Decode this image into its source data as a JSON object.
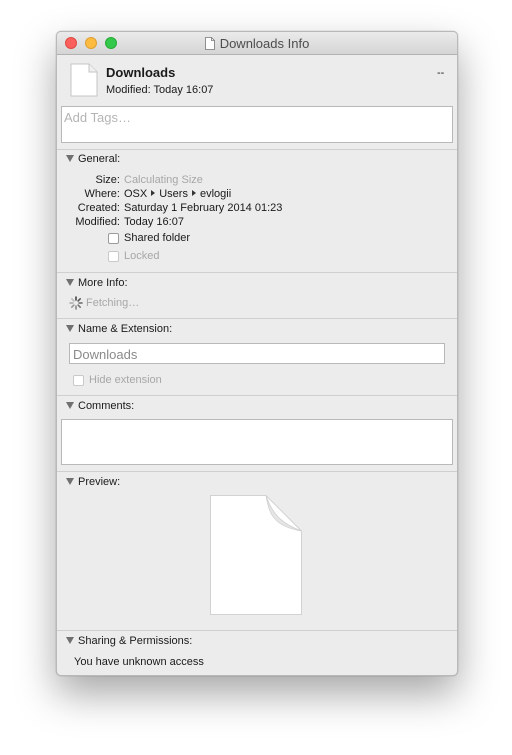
{
  "window": {
    "title": "Downloads Info"
  },
  "header": {
    "name": "Downloads",
    "modified": "Modified: Today 16:07",
    "size_summary": "--"
  },
  "tags": {
    "placeholder": "Add Tags…"
  },
  "general": {
    "title": "General:",
    "size_label": "Size:",
    "size_value": "Calculating Size",
    "where_label": "Where:",
    "where_path": [
      "OSX",
      "Users",
      "evlogii"
    ],
    "created_label": "Created:",
    "created_value": "Saturday 1 February 2014 01:23",
    "modified_label": "Modified:",
    "modified_value": "Today 16:07",
    "shared_folder": "Shared folder",
    "locked": "Locked"
  },
  "more_info": {
    "title": "More Info:",
    "status": "Fetching…"
  },
  "name_extension": {
    "title": "Name & Extension:",
    "name_value": "Downloads",
    "hide_extension": "Hide extension"
  },
  "comments": {
    "title": "Comments:"
  },
  "preview": {
    "title": "Preview:"
  },
  "sharing": {
    "title": "Sharing & Permissions:",
    "access": "You have unknown access"
  }
}
